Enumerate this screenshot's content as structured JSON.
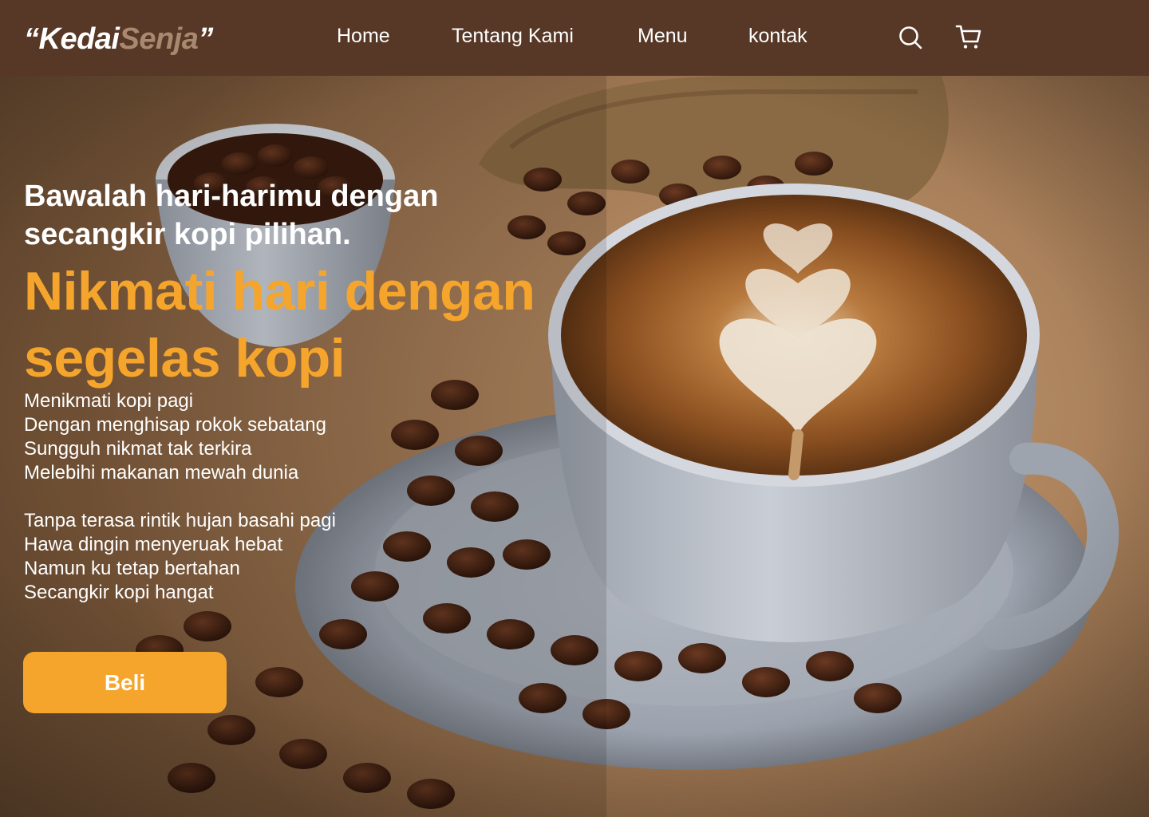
{
  "brand": {
    "quote_open": "“",
    "name_primary": "Kedai",
    "name_accent": "Senja",
    "quote_close": "”"
  },
  "nav": {
    "home": "Home",
    "about": "Tentang Kami",
    "menu": "Menu",
    "contact": "kontak",
    "search_icon": "search-icon",
    "cart_icon": "shopping-cart-icon"
  },
  "hero": {
    "tagline": "Bawalah hari-harimu dengan secangkir kopi  pilihan.",
    "headline": "Nikmati hari dengan segelas kopi",
    "poem": {
      "stanza1": [
        "Menikmati kopi pagi",
        "Dengan menghisap rokok sebatang",
        "Sungguh nikmat tak terkira",
        "Melebihi makanan mewah dunia"
      ],
      "stanza2": [
        "Tanpa terasa rintik hujan basahi pagi",
        "Hawa dingin menyeruak hebat",
        "Namun ku tetap bertahan",
        "Secangkir kopi hangat"
      ]
    },
    "cta_label": "Beli",
    "background_image": "coffee cup with latte art on saucer with coffee beans"
  },
  "colors": {
    "navbar": "#573726",
    "accent": "#f6a52c",
    "logo_accent": "#a8896f",
    "text": "#ffffff"
  }
}
